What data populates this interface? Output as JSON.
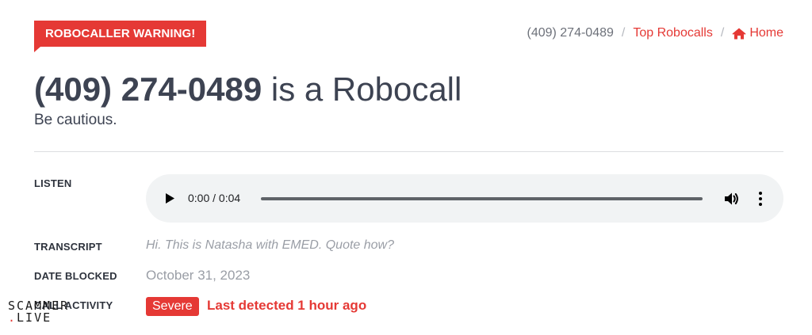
{
  "badge": {
    "label": "ROBOCALLER WARNING!"
  },
  "breadcrumb": {
    "current": "(409) 274-0489",
    "separator": "/",
    "top_robocalls": "Top Robocalls",
    "home": "Home"
  },
  "heading": {
    "number": "(409) 274-0489",
    "rest": "is a Robocall",
    "subtitle": "Be cautious."
  },
  "fields": {
    "listen_label": "LISTEN",
    "transcript_label": "TRANSCRIPT",
    "date_label": "DATE BLOCKED",
    "activity_label": "CALL ACTIVITY"
  },
  "player": {
    "time": "0:00 / 0:04",
    "progress": 0
  },
  "transcript": "Hi. This is Natasha with EMED. Quote how?",
  "date_blocked": "October 31, 2023",
  "activity": {
    "level": "Severe",
    "last_detected": "Last detected 1 hour ago"
  },
  "watermark": {
    "line1": "SCAMMER",
    "line2": "LIVE",
    "dot": "."
  },
  "colors": {
    "accent": "#e53935",
    "text": "#3d4352",
    "muted": "#9a9ea6",
    "player_bg": "#f1f3f4"
  },
  "icons": {
    "home": "home-icon",
    "play": "play-icon",
    "volume": "volume-icon",
    "more": "more-vertical-icon"
  }
}
